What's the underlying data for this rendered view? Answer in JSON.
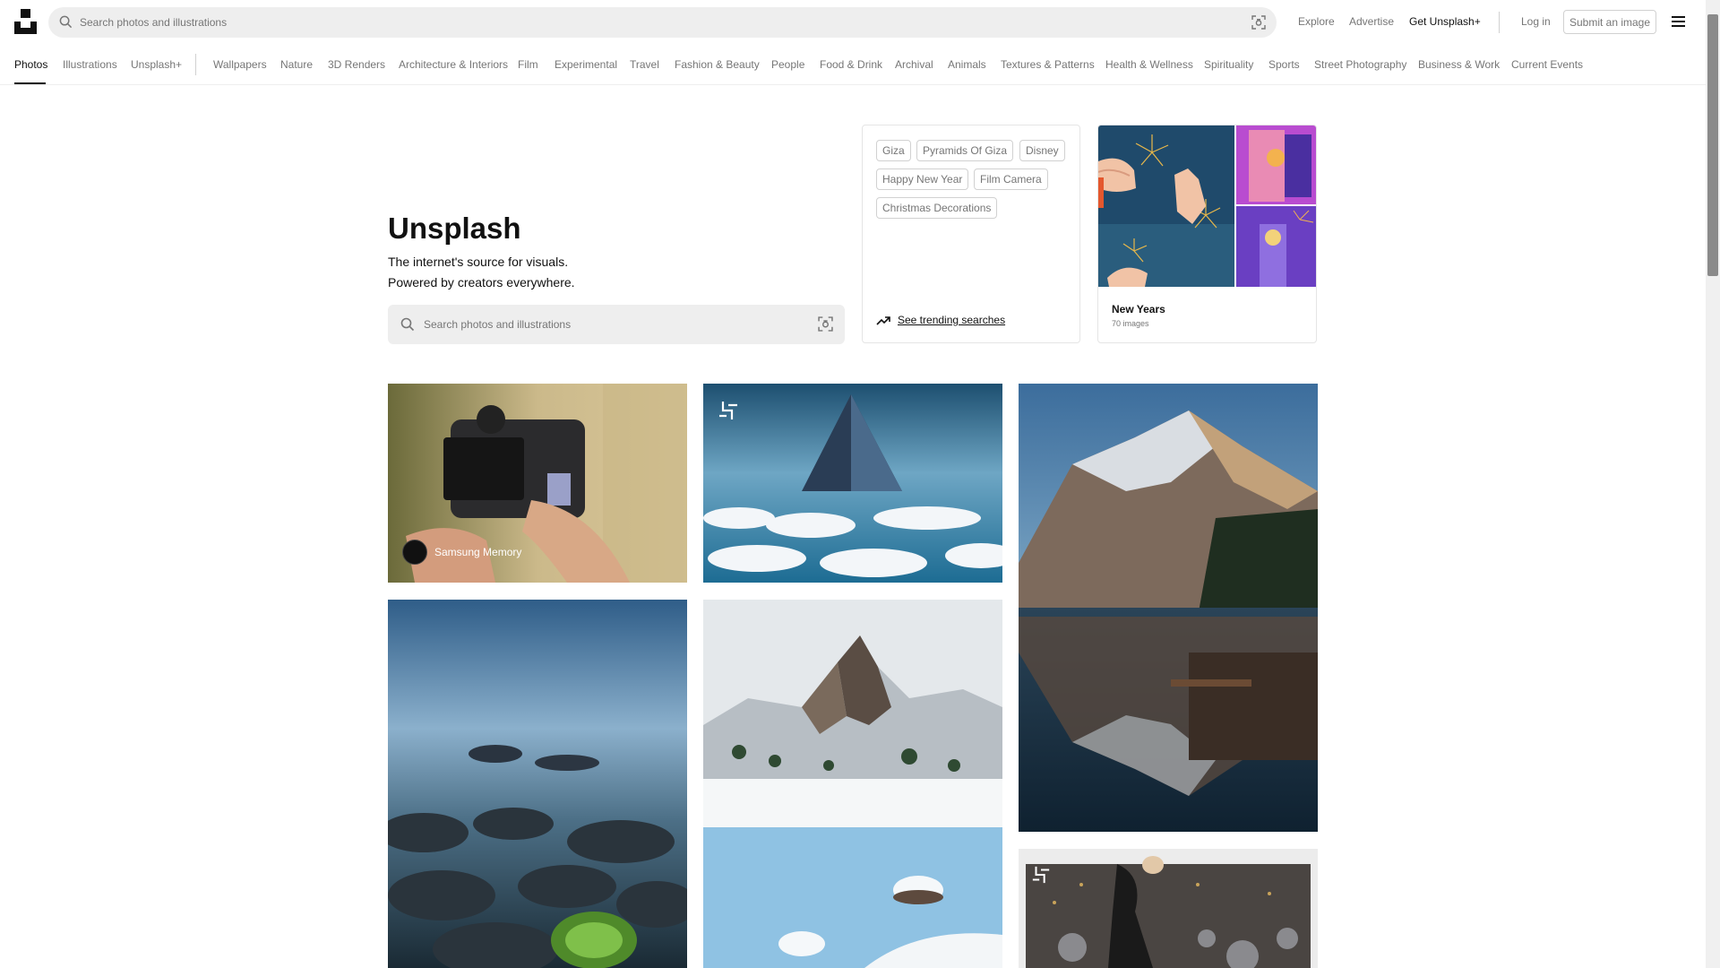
{
  "header": {
    "search_placeholder": "Search photos and illustrations",
    "links": {
      "explore": "Explore",
      "advertise": "Advertise",
      "get_plus": "Get Unsplash+",
      "login": "Log in",
      "submit": "Submit an image"
    }
  },
  "categories": [
    "Photos",
    "Illustrations",
    "Unsplash+",
    "Wallpapers",
    "Nature",
    "3D Renders",
    "Architecture & Interiors",
    "Film",
    "Experimental",
    "Travel",
    "Fashion & Beauty",
    "People",
    "Food & Drink",
    "Archival",
    "Animals",
    "Textures & Patterns",
    "Health & Wellness",
    "Spirituality",
    "Sports",
    "Street Photography",
    "Business & Work",
    "Current Events"
  ],
  "active_category": "Photos",
  "hero": {
    "title": "Unsplash",
    "line1": "The internet's source for visuals.",
    "line2": "Powered by creators everywhere.",
    "search_placeholder": "Search photos and illustrations"
  },
  "trending": {
    "tags": [
      "Giza",
      "Pyramids Of Giza",
      "Disney",
      "Happy New Year",
      "Film Camera",
      "Christmas Decorations"
    ],
    "link_label": "See trending searches"
  },
  "collection": {
    "title": "New Years",
    "count": "70 images"
  },
  "photos": {
    "first_credit": "Samsung Memory"
  },
  "colors": {
    "background": "#ffffff",
    "search_bg": "#eeeeee",
    "muted_text": "#767676",
    "border": "#d1d1d1"
  }
}
